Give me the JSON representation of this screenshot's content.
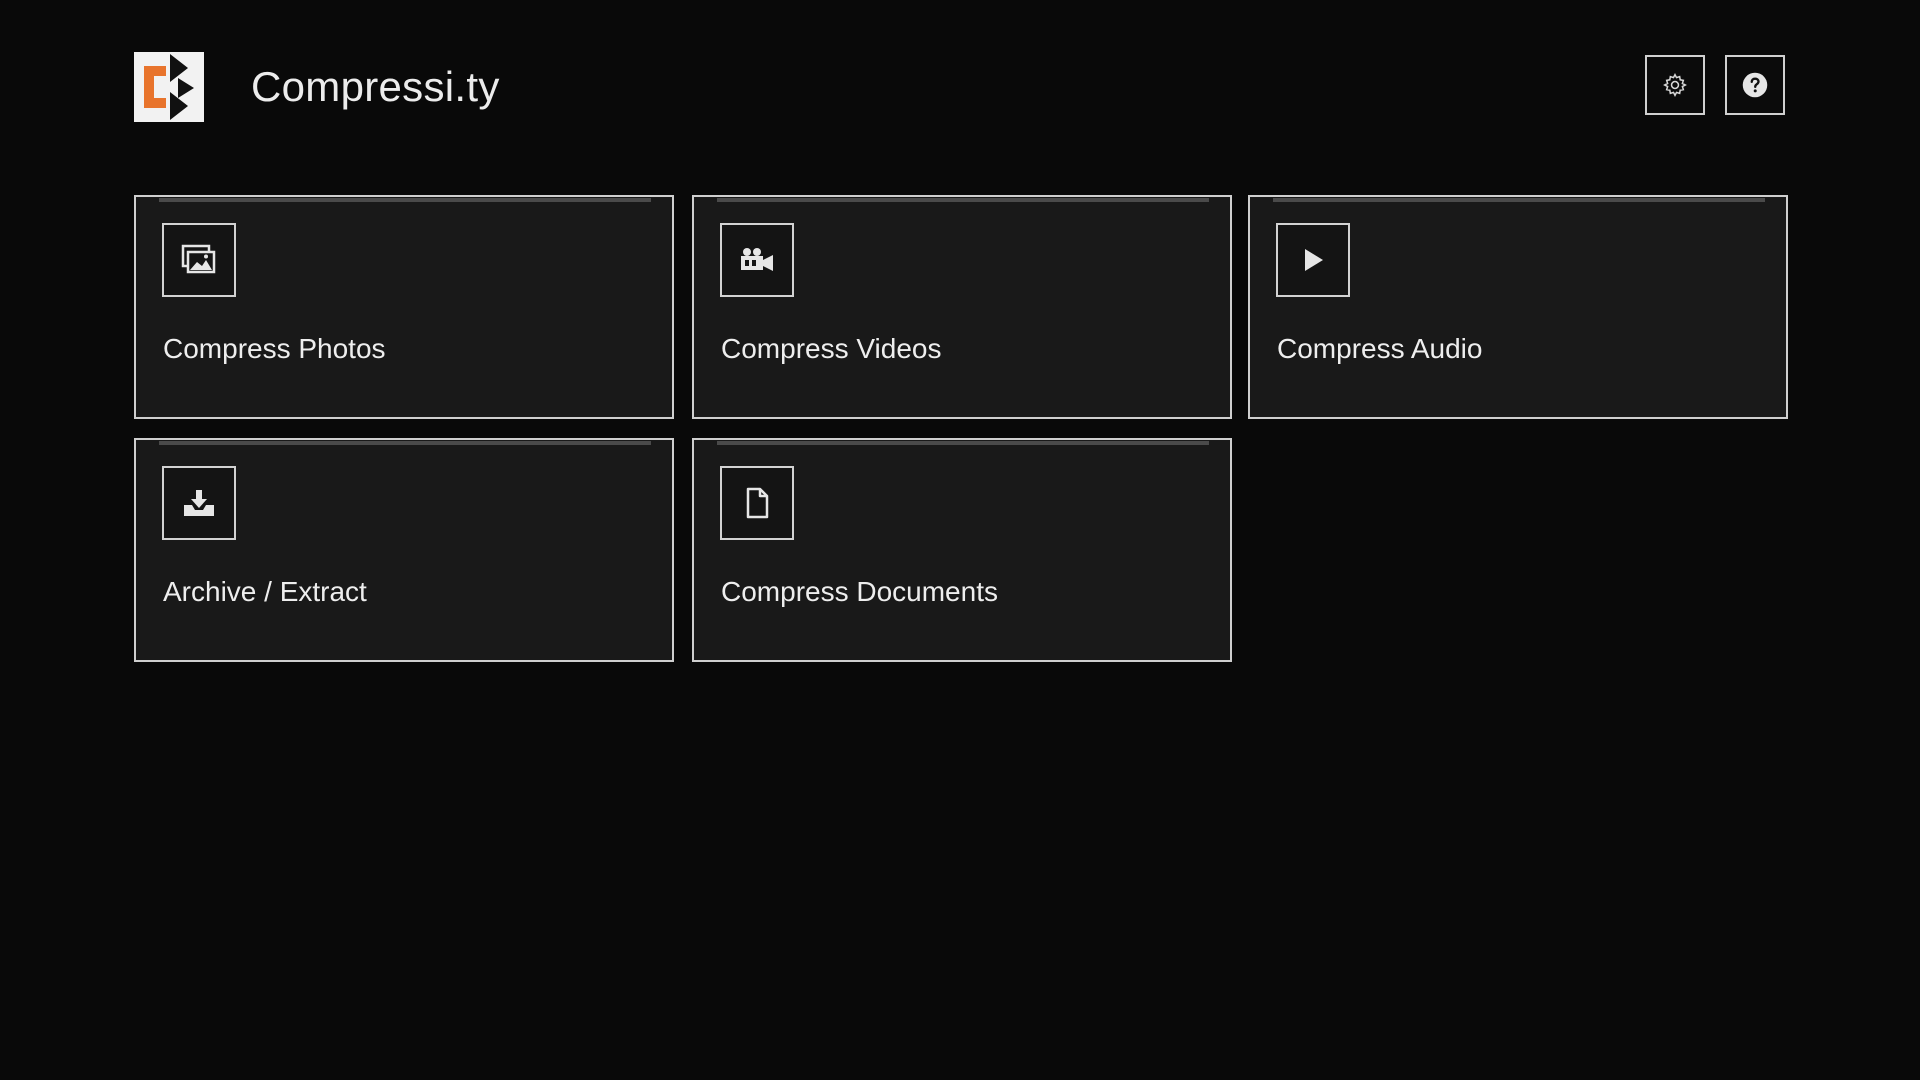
{
  "app": {
    "title": "Compressi.ty",
    "logo_icon": "compressity-logo-icon",
    "accent_color": "#e8742c"
  },
  "header": {
    "settings_icon": "gear-icon",
    "help_icon": "question-circle-icon"
  },
  "cards": [
    {
      "id": "photos",
      "label": "Compress Photos",
      "icon": "images-icon"
    },
    {
      "id": "videos",
      "label": "Compress Videos",
      "icon": "video-camera-icon"
    },
    {
      "id": "audio",
      "label": "Compress Audio",
      "icon": "play-icon"
    },
    {
      "id": "archive",
      "label": "Archive / Extract",
      "icon": "download-tray-icon"
    },
    {
      "id": "documents",
      "label": "Compress Documents",
      "icon": "document-icon"
    }
  ]
}
